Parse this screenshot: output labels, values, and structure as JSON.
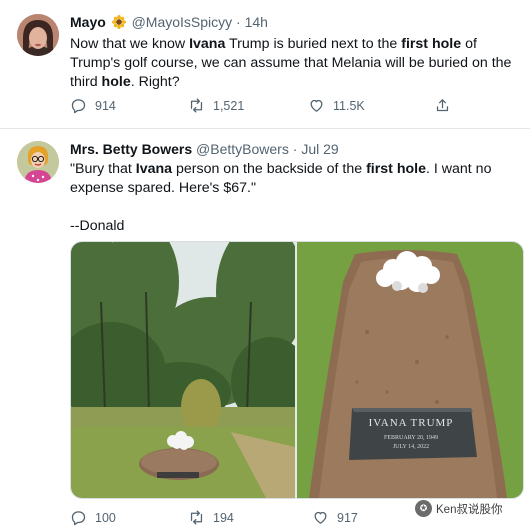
{
  "tweets": [
    {
      "name": "Mayo",
      "handle": "@MayoIsSpicyy",
      "separator": "·",
      "time": "14h",
      "text_parts": [
        {
          "t": "Now that we know ",
          "b": false
        },
        {
          "t": "Ivana",
          "b": true
        },
        {
          "t": " Trump is buried next to the ",
          "b": false
        },
        {
          "t": "first hole",
          "b": true
        },
        {
          "t": " of Trump's golf course, we can assume that Melania will be buried on the third ",
          "b": false
        },
        {
          "t": "hole",
          "b": true
        },
        {
          "t": ". Right?",
          "b": false
        }
      ],
      "replies": "914",
      "retweets": "1,521",
      "likes": "11.5K"
    },
    {
      "name": "Mrs. Betty Bowers",
      "handle": "@BettyBowers",
      "separator": "·",
      "time": "Jul 29",
      "text_parts": [
        {
          "t": "\"Bury that ",
          "b": false
        },
        {
          "t": "Ivana",
          "b": true
        },
        {
          "t": " person on the backside of the ",
          "b": false
        },
        {
          "t": "first hole",
          "b": true
        },
        {
          "t": ". I want no expense spared. Here's $67.\"",
          "b": false
        }
      ],
      "signature": "--Donald",
      "headstone": {
        "name": "IVANA TRUMP",
        "born": "FEBRUARY 20, 1949",
        "died": "JULY 14, 2022"
      },
      "replies": "100",
      "retweets": "194",
      "likes": "917"
    }
  ],
  "watermark": "Ken叔说股你",
  "colors": {
    "text": "#0f1419",
    "muted": "#536471",
    "divider": "#e4e7ea"
  },
  "icons": [
    "sunflower-icon",
    "reply-icon",
    "retweet-icon",
    "like-icon",
    "share-icon"
  ]
}
